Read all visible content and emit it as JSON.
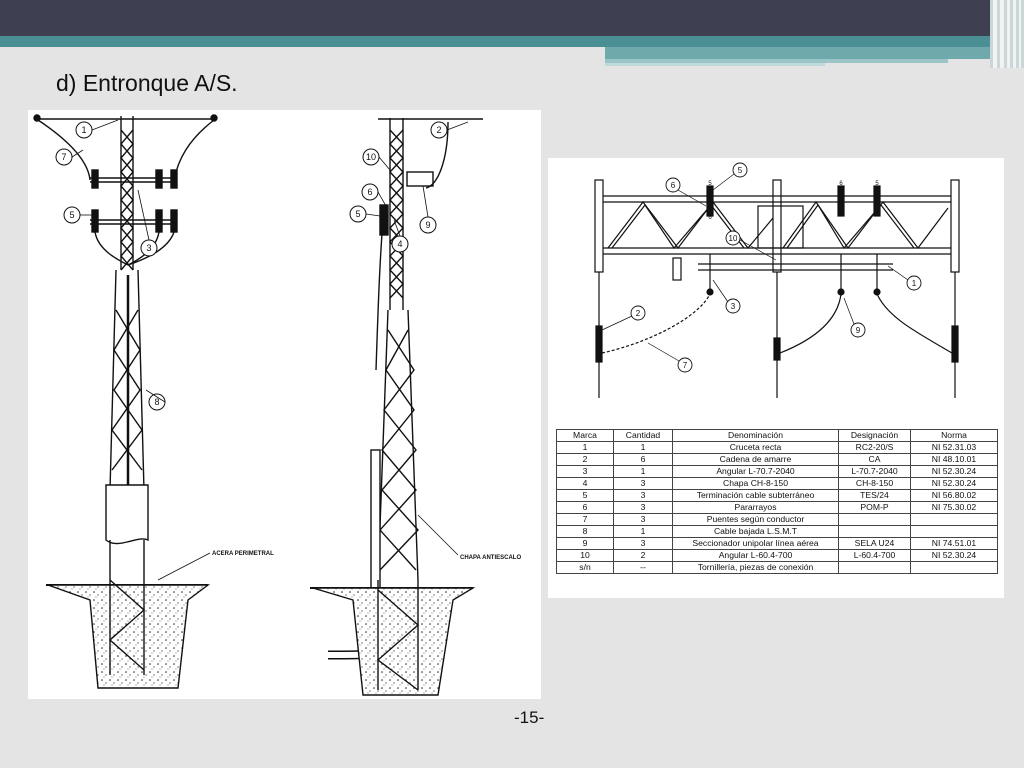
{
  "slide": {
    "title": "d) Entronque A/S.",
    "page_number": "-15-"
  },
  "left_drawing": {
    "label_acera": "ACERA PERIMETRAL",
    "label_chapa": "CHAPA ANTIESCALO",
    "callouts": {
      "c1": "1",
      "c7": "7",
      "c5a": "5",
      "c3": "3",
      "c8": "8",
      "c2": "2",
      "c10": "10",
      "c6": "6",
      "c5b": "5",
      "c9": "9",
      "c4": "4"
    }
  },
  "right_drawing": {
    "callouts": {
      "c6": "6",
      "c5": "5",
      "c10": "10",
      "c1": "1",
      "c2": "2",
      "c3": "3",
      "c9": "9",
      "c7": "7"
    },
    "top_labels": {
      "t1": "5",
      "t2": "6",
      "t3": "6",
      "t4": "5"
    }
  },
  "parts_table": {
    "headers": [
      "Marca",
      "Cantidad",
      "Denominación",
      "Designación",
      "Norma"
    ],
    "rows": [
      [
        "1",
        "1",
        "Cruceta recta",
        "RC2-20/S",
        "NI 52.31.03"
      ],
      [
        "2",
        "6",
        "Cadena de amarre",
        "CA",
        "NI 48.10.01"
      ],
      [
        "3",
        "1",
        "Angular L-70.7-2040",
        "L-70.7-2040",
        "NI 52.30.24"
      ],
      [
        "4",
        "3",
        "Chapa CH-8-150",
        "CH-8-150",
        "NI 52.30.24"
      ],
      [
        "5",
        "3",
        "Terminación cable subterráneo",
        "TES/24",
        "NI 56.80.02"
      ],
      [
        "6",
        "3",
        "Pararrayos",
        "POM-P",
        "NI 75.30.02"
      ],
      [
        "7",
        "3",
        "Puentes según conductor",
        "",
        ""
      ],
      [
        "8",
        "1",
        "Cable bajada L.S.M.T",
        "",
        ""
      ],
      [
        "9",
        "3",
        "Seccionador unipolar línea aérea",
        "SELA U24",
        "NI 74.51.01"
      ],
      [
        "10",
        "2",
        "Angular L-60.4-700",
        "L-60.4-700",
        "NI 52.30.24"
      ],
      [
        "s/n",
        "--",
        "Tornillería, piezas de conexión",
        "",
        ""
      ]
    ]
  }
}
